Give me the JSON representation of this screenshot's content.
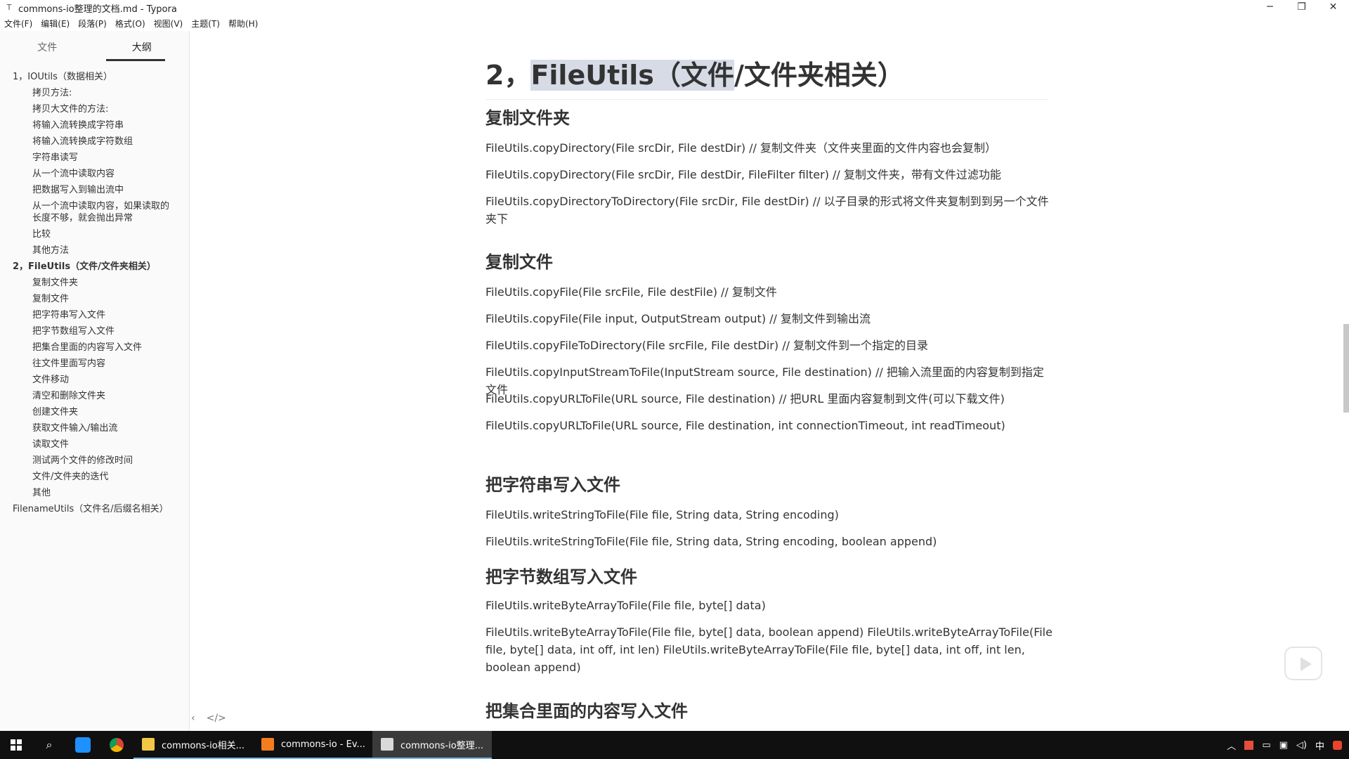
{
  "window": {
    "icon": "T",
    "title": "commons-io整理的文档.md - Typora",
    "controls": [
      "─",
      "❐",
      "✕"
    ]
  },
  "menu": [
    "文件(F)",
    "编辑(E)",
    "段落(P)",
    "格式(O)",
    "视图(V)",
    "主题(T)",
    "帮助(H)"
  ],
  "sidebar": {
    "tabs": [
      "文件",
      "大纲"
    ],
    "active_tab": "大纲",
    "outline": [
      {
        "label": "1，IOUtils（数据相关）",
        "level": 1
      },
      {
        "label": "拷贝方法:",
        "level": 2
      },
      {
        "label": "拷贝大文件的方法:",
        "level": 2
      },
      {
        "label": "将输入流转换成字符串",
        "level": 2
      },
      {
        "label": "将输入流转换成字符数组",
        "level": 2
      },
      {
        "label": "字符串读写",
        "level": 2
      },
      {
        "label": "从一个流中读取内容",
        "level": 2
      },
      {
        "label": "把数据写入到输出流中",
        "level": 2
      },
      {
        "label": "从一个流中读取内容，如果读取的长度不够，就会抛出异常",
        "level": 2
      },
      {
        "label": "比较",
        "level": 2
      },
      {
        "label": "其他方法",
        "level": 2
      },
      {
        "label": "2，FileUtils（文件/文件夹相关）",
        "level": 1
      },
      {
        "label": "复制文件夹",
        "level": 2
      },
      {
        "label": "复制文件",
        "level": 2
      },
      {
        "label": "把字符串写入文件",
        "level": 2
      },
      {
        "label": "把字节数组写入文件",
        "level": 2
      },
      {
        "label": "把集合里面的内容写入文件",
        "level": 2
      },
      {
        "label": "往文件里面写内容",
        "level": 2
      },
      {
        "label": "文件移动",
        "level": 2
      },
      {
        "label": "清空和删除文件夹",
        "level": 2
      },
      {
        "label": "创建文件夹",
        "level": 2
      },
      {
        "label": "获取文件输入/输出流",
        "level": 2
      },
      {
        "label": "读取文件",
        "level": 2
      },
      {
        "label": "测试两个文件的修改时间",
        "level": 2
      },
      {
        "label": "文件/文件夹的迭代",
        "level": 2
      },
      {
        "label": "其他",
        "level": 2
      },
      {
        "label": "FilenameUtils（文件名/后缀名相关）",
        "level": 1
      }
    ],
    "bottom_icons": [
      "‹",
      "</>"
    ]
  },
  "doc": {
    "h2_prefix": "2，",
    "h2_selected": "FileUtils（文件",
    "h2_suffix": "/文件夹相关）",
    "sections": {
      "copy_dir": {
        "title": "复制文件夹",
        "lines": [
          "FileUtils.copyDirectory(File srcDir, File destDir) // 复制文件夹（文件夹里面的文件内容也会复制）",
          "FileUtils.copyDirectory(File srcDir, File destDir, FileFilter filter) // 复制文件夹，带有文件过滤功能",
          "FileUtils.copyDirectoryToDirectory(File srcDir, File destDir) // 以子目录的形式将文件夹复制到到另一个文件夹下"
        ]
      },
      "copy_file": {
        "title": "复制文件",
        "lines": [
          "FileUtils.copyFile(File srcFile, File destFile) // 复制文件",
          "FileUtils.copyFile(File input, OutputStream output) // 复制文件到输出流",
          "FileUtils.copyFileToDirectory(File srcFile, File destDir) // 复制文件到一个指定的目录",
          "FileUtils.copyInputStreamToFile(InputStream source, File destination) // 把输入流里面的内容复制到指定文件",
          "FileUtils.copyURLToFile(URL source, File destination) // 把URL 里面内容复制到文件(可以下载文件)",
          "FileUtils.copyURLToFile(URL source, File destination, int connectionTimeout, int readTimeout)"
        ]
      },
      "write_string": {
        "title": "把字符串写入文件",
        "lines": [
          "FileUtils.writeStringToFile(File file, String data, String encoding)",
          "FileUtils.writeStringToFile(File file, String data, String encoding, boolean append)"
        ]
      },
      "write_bytes": {
        "title": "把字节数组写入文件",
        "lines": [
          "FileUtils.writeByteArrayToFile(File file, byte[] data)",
          "FileUtils.writeByteArrayToFile(File file, byte[] data, boolean append) FileUtils.writeByteArrayToFile(File file, byte[] data, int off, int len) FileUtils.writeByteArrayToFile(File file, byte[] data, int off, int len, boolean append)"
        ]
      },
      "write_collection": {
        "title": "把集合里面的内容写入文件"
      }
    }
  },
  "taskbar": {
    "apps": [
      {
        "label": "commons-io相关...",
        "color": "#f2c744"
      },
      {
        "label": "commons-io - Ev...",
        "color": "#f47d20"
      },
      {
        "label": "commons-io整理...",
        "color": "#d9d9d9"
      }
    ],
    "tray_lang": "中"
  }
}
